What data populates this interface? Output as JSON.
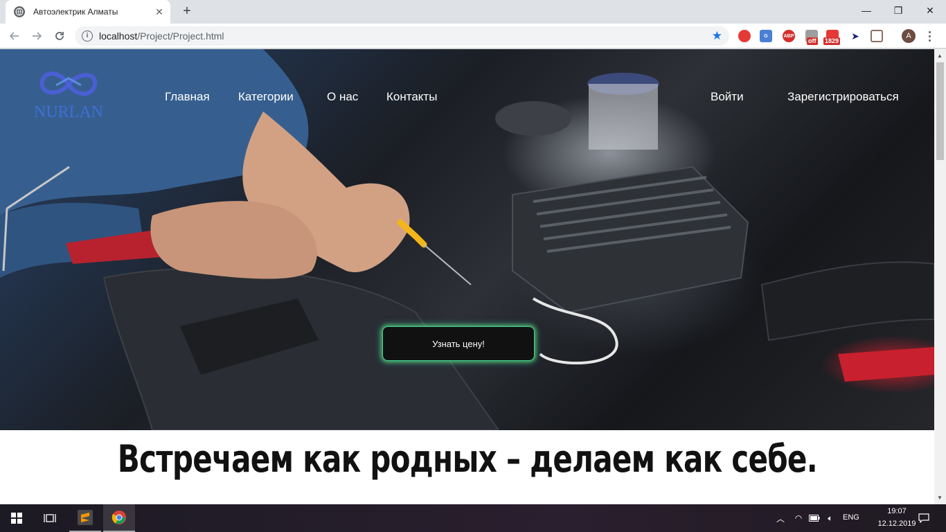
{
  "browser": {
    "tab_title": "Автоэлектрик Алматы",
    "tab_close": "✕",
    "new_tab": "+",
    "url_host": "localhost",
    "url_path": "/Project/Project.html",
    "profile_initial": "A",
    "extensions": [
      "adblock-icon",
      "translate-icon",
      "abp-icon",
      "off-icon",
      "mail-icon",
      "cursor-icon",
      "cast-icon"
    ],
    "ext_abp_label": "ABP",
    "ext_off_badge": "off",
    "ext_mail_badge": "1829"
  },
  "window_controls": {
    "minimize": "—",
    "restore": "❐",
    "close": "✕"
  },
  "page": {
    "logo_text": "NURLAN",
    "nav": {
      "home": "Главная",
      "categories": "Категории",
      "about": "О нас",
      "contacts": "Контакты",
      "login": "Войти",
      "register": "Зарегистрироваться"
    },
    "cta_button": "Узнать цену!",
    "slogan": "Встречаем как родных – делаем как себе."
  },
  "taskbar": {
    "language": "ENG",
    "time": "19:07",
    "date": "12.12.2019"
  },
  "colors": {
    "logo_blue": "#3f6fd8",
    "cta_glow": "#3fcf9a",
    "star_blue": "#1a73e8"
  }
}
